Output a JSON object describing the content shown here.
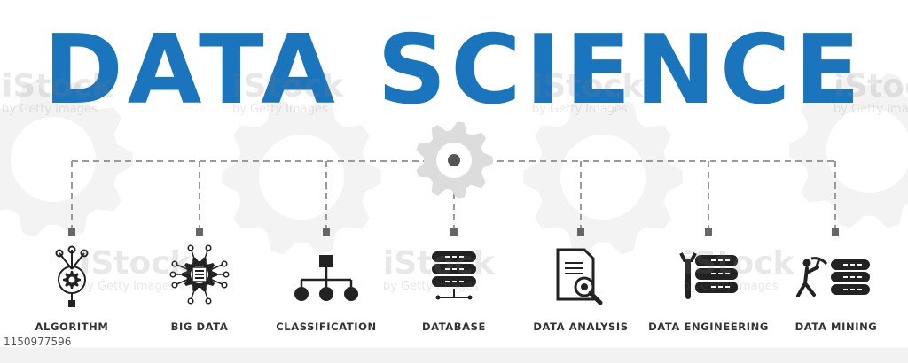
{
  "title": "DATA SCIENCE",
  "colors": {
    "accent": "#1b75bc",
    "icon": "#222222",
    "gear": "#dcdcdc",
    "gear_bg": "#f3f3f3",
    "dash": "#9a9a9a"
  },
  "items": [
    {
      "label": "ALGORITHM",
      "icon": "algorithm-icon"
    },
    {
      "label": "BIG DATA",
      "icon": "big-data-icon"
    },
    {
      "label": "CLASSIFICATION",
      "icon": "classification-icon"
    },
    {
      "label": "DATABASE",
      "icon": "database-icon"
    },
    {
      "label": "DATA ANALYSIS",
      "icon": "data-analysis-icon"
    },
    {
      "label": "DATA ENGINEERING",
      "icon": "data-engineering-icon"
    },
    {
      "label": "DATA MINING",
      "icon": "data-mining-icon"
    }
  ],
  "watermark": {
    "brand": "iStock",
    "credit": "by Getty Images"
  },
  "image_id": "1150977596"
}
